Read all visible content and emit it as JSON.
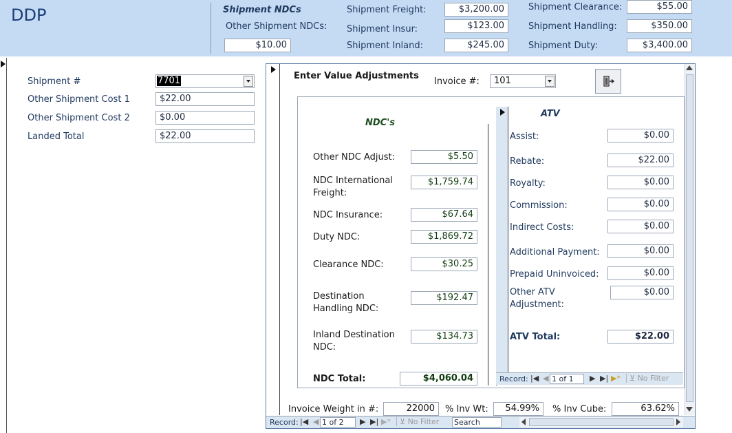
{
  "header": {
    "title": "DDP",
    "shipment_ndcs_label": "Shipment NDCs",
    "other_shipment_ndcs_label": "Other Shipment NDCs:",
    "other_shipment_ndcs_value": "$10.00",
    "freight_label": "Shipment Freight:",
    "freight_value": "$3,200.00",
    "insur_label": "Shipment Insur:",
    "insur_value": "$123.00",
    "inland_label": "Shipment Inland:",
    "inland_value": "$245.00",
    "clearance_label": "Shipment Clearance:",
    "clearance_value": "$55.00",
    "handling_label": "Shipment Handling:",
    "handling_value": "$350.00",
    "duty_label": "Shipment Duty:",
    "duty_value": "$3,400.00",
    "bg_color": "#c5daf3"
  },
  "left": {
    "shipment_label": "Shipment #",
    "shipment_value": "7701",
    "cost1_label": "Other Shipment Cost 1",
    "cost1_value": "$22.00",
    "cost2_label": "Other Shipment Cost 2",
    "cost2_value": "$0.00",
    "landed_label": "Landed Total",
    "landed_value": "$22.00"
  },
  "subform": {
    "title": "Enter Value Adjustments",
    "invoice_label": "Invoice #:",
    "invoice_value": "101",
    "exit_icon": "exit-door-icon",
    "ndc_header": "NDC's",
    "ndc_rows": [
      {
        "label": "Other NDC Adjust:",
        "value": "$5.50"
      },
      {
        "label": "NDC International\nFreight:",
        "value": "$1,759.74"
      },
      {
        "label": "NDC Insurance:",
        "value": "$67.64"
      },
      {
        "label": "Duty NDC:",
        "value": "$1,869.72"
      },
      {
        "label": "Clearance NDC:",
        "value": "$30.25"
      },
      {
        "label": "Destination\nHandling NDC:",
        "value": "$192.47"
      },
      {
        "label": "Inland Destination\nNDC:",
        "value": "$134.73"
      }
    ],
    "ndc_total_label": "NDC Total:",
    "ndc_total_value": "$4,060.04",
    "atv_header": "ATV",
    "atv_rows": [
      {
        "label": "Assist:",
        "value": "$0.00"
      },
      {
        "label": "Rebate:",
        "value": "$22.00"
      },
      {
        "label": "Royalty:",
        "value": "$0.00"
      },
      {
        "label": "Commission:",
        "value": "$0.00"
      },
      {
        "label": "Indirect Costs:",
        "value": "$0.00"
      },
      {
        "label": "Additional Payment:",
        "value": "$0.00"
      },
      {
        "label": "Prepaid Uninvoiced:",
        "value": "$0.00"
      },
      {
        "label": "Other ATV\nAdjustment:",
        "value": "$0.00"
      }
    ],
    "atv_total_label": "ATV Total:",
    "atv_total_value": "$22.00",
    "atv_nav": {
      "record_label": "Record:",
      "position": "1 of 1",
      "filter": "No Filter"
    },
    "weight_label": "Invoice Weight in #:",
    "weight_value": "22000",
    "pct_wt_label": "% Inv Wt:",
    "pct_wt_value": "54.99%",
    "pct_cube_label": "% Inv Cube:",
    "pct_cube_value": "63.62%",
    "nav": {
      "record_label": "Record:",
      "position": "1 of 2",
      "filter": "No Filter",
      "search": "Search"
    }
  }
}
